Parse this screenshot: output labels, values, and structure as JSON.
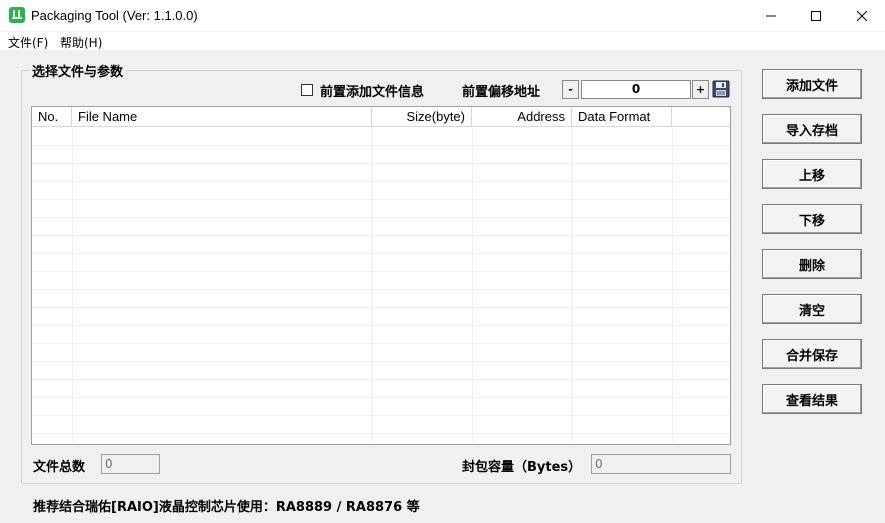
{
  "window": {
    "title": "Packaging Tool (Ver: 1.1.0.0)"
  },
  "menu": {
    "file": "文件(F)",
    "help": "帮助(H)"
  },
  "group": {
    "title": "选择文件与参数",
    "prepend_checkbox_label": "前置添加文件信息",
    "prepend_checked": false,
    "offset_label": "前置偏移地址",
    "offset_minus": "-",
    "offset_value": "0",
    "offset_plus": "+"
  },
  "table": {
    "columns": [
      "No.",
      "File Name",
      "Size(byte)",
      "Address",
      "Data Format"
    ],
    "rows": []
  },
  "buttons": {
    "add_file": "添加文件",
    "import_archive": "导入存档",
    "move_up": "上移",
    "move_down": "下移",
    "delete": "删除",
    "clear": "清空",
    "merge_save": "合并保存",
    "view_result": "查看结果"
  },
  "footer": {
    "file_count_label": "文件总数",
    "file_count_value": "0",
    "capacity_label": "封包容量（Bytes）",
    "capacity_value": "0",
    "recommend_text": "推荐结合瑞佑[RAIO]液晶控制芯片使用：RA8889 / RA8876 等"
  }
}
